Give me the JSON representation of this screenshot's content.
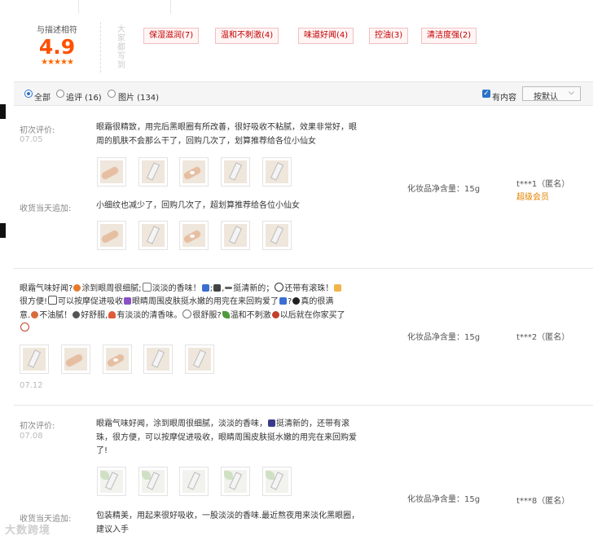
{
  "summary": {
    "score_label": "与描述相符",
    "score": "4.9",
    "stars": "★★★★★",
    "vertical_label": "大家都写到",
    "tags": [
      "保湿滋润(7)",
      "温和不刺激(4)",
      "味道好闻(4)",
      "控油(3)",
      "清洁度强(2)"
    ]
  },
  "filter": {
    "all": "全部",
    "followup": "追评 (16)",
    "images": "图片 (134)",
    "has_content": "有内容",
    "sort": "按默认"
  },
  "reviews": [
    {
      "first_label": "初次评价:",
      "first_date": "07.05",
      "first_text_line1": "眼霜很精致，用完后黑眼圈有所改善，很好吸收不粘腻，效果非常好，眼",
      "first_text_line2": "周的肌肤不会那么干了，回购几次了，划算推荐给各位小仙女",
      "followup_label": "收货当天追加:",
      "followup_text": "小细纹也减少了，回购几次了，超划算推荐给各位小仙女",
      "spec": "化妆品净含量：15g",
      "user": "t***1（匿名）",
      "member": "超级会员"
    },
    {
      "text_line1_a": "眼霜气味好闻?",
      "text_line1_b": "涂到眼周很细腻;",
      "text_line1_c": "淡淡的香味！",
      "text_line1_d": ";",
      "text_line1_e": ",",
      "text_line1_f": "挺清新的；",
      "text_line1_g": "还带有滚珠！",
      "text_line2_a": "很方便!",
      "text_line2_b": "可以按摩促进吸收",
      "text_line2_c": "眼睛周围皮肤挺水嫩的用完在来回购爱了",
      "text_line2_d": "?",
      "text_line2_e": "真的很满",
      "text_line3_a": "意.",
      "text_line3_b": "不油腻！",
      "text_line3_c": "好舒服,",
      "text_line3_d": "有淡淡的清香味。",
      "text_line3_e": "很舒服?",
      "text_line3_f": "温和不刺激",
      "text_line3_g": "以后就在你家买了",
      "date": "07.12",
      "spec": "化妆品净含量：15g",
      "user": "t***2（匿名）"
    },
    {
      "first_label": "初次评价:",
      "first_date": "07.08",
      "first_text_line1": "眼霜气味好闻，涂到眼周很细腻，淡淡的香味，",
      "first_text_line1_b": "挺清新的，还带有滚",
      "first_text_line2": "珠，很方便，可以按摩促进吸收，眼睛周围皮肤挺水嫩的用完在来回购爱",
      "first_text_line3": "了!",
      "followup_label": "收货当天追加:",
      "followup_text_line1": "包装精美，用起来很好吸收，一股淡淡的香味.最近熬夜用来淡化黑眼圈，",
      "followup_text_line2": "建议入手",
      "spec": "化妆品净含量：15g",
      "user": "t***8（匿名）"
    }
  ],
  "watermark": "大数跨境",
  "colors": {
    "accent": "#ff5000",
    "tag_text": "#c40000",
    "member": "#e38200",
    "link": "#2a72c8"
  }
}
